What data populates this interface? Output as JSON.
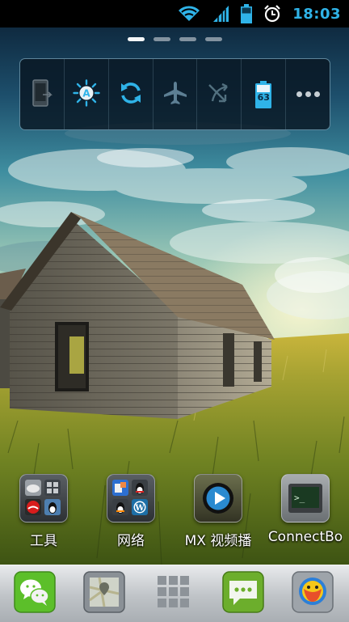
{
  "status_bar": {
    "time": "18:03",
    "icons": [
      "wifi-icon",
      "signal-icon",
      "battery-icon",
      "alarm-icon"
    ],
    "accent_color": "#2fb3e8"
  },
  "page_indicator": {
    "total": 4,
    "active": 1
  },
  "quick_toggles": {
    "items": [
      {
        "name": "screen-timeout",
        "icon": "phone-screen-icon"
      },
      {
        "name": "auto-brightness",
        "icon": "brightness-auto-icon"
      },
      {
        "name": "auto-sync",
        "icon": "sync-icon"
      },
      {
        "name": "airplane-mode",
        "icon": "airplane-icon"
      },
      {
        "name": "mobile-data",
        "icon": "data-off-icon"
      },
      {
        "name": "battery",
        "icon": "battery-icon",
        "value": "63"
      },
      {
        "name": "more",
        "icon": "more-dots-icon"
      }
    ]
  },
  "shortcuts": [
    {
      "label": "工具",
      "icon": "folder-tools-icon"
    },
    {
      "label": "网络",
      "icon": "folder-network-icon"
    },
    {
      "label": "MX 视频播",
      "icon": "mx-player-icon"
    },
    {
      "label": "ConnectBo",
      "icon": "terminal-icon"
    }
  ],
  "dock": [
    {
      "name": "wechat",
      "icon": "wechat-icon"
    },
    {
      "name": "maps",
      "icon": "maps-icon"
    },
    {
      "name": "app-drawer",
      "icon": "app-drawer-icon"
    },
    {
      "name": "messaging",
      "icon": "messaging-icon"
    },
    {
      "name": "qq-browser",
      "icon": "qq-browser-icon"
    }
  ]
}
